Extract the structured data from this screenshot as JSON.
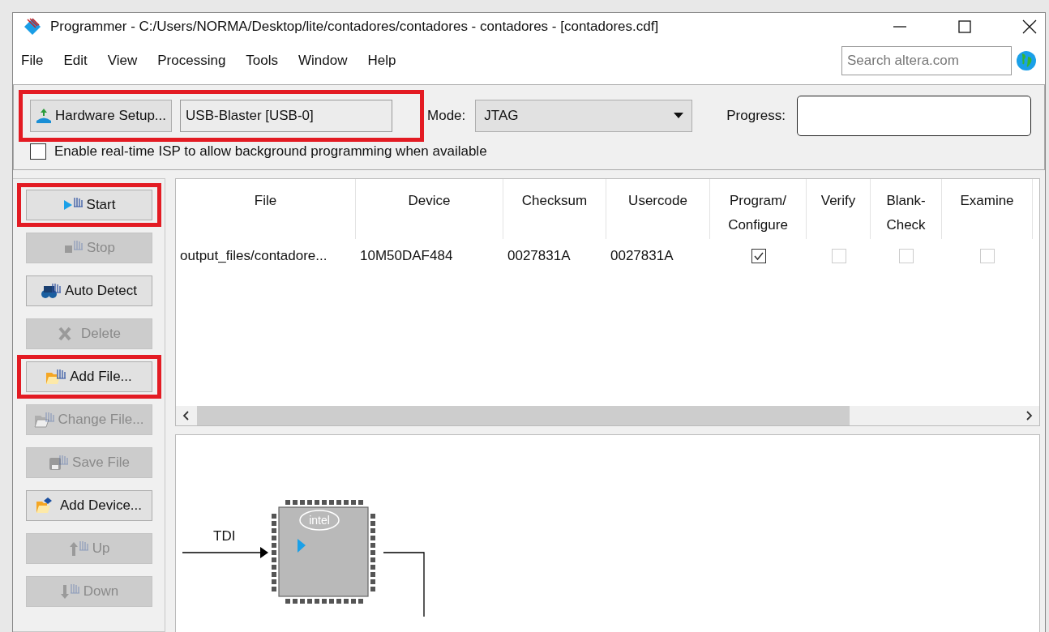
{
  "window": {
    "title": "Programmer - C:/Users/NORMA/Desktop/lite/contadores/contadores - contadores - [contadores.cdf]"
  },
  "menu": [
    "File",
    "Edit",
    "View",
    "Processing",
    "Tools",
    "Window",
    "Help"
  ],
  "search": {
    "placeholder": "Search altera.com"
  },
  "hardware": {
    "button": "Hardware Setup...",
    "device": "USB-Blaster [USB-0]",
    "highlighted": true
  },
  "mode": {
    "label": "Mode:",
    "value": "JTAG"
  },
  "progress": {
    "label": "Progress:"
  },
  "isp": {
    "label": "Enable real-time ISP to allow background programming when available",
    "checked": false
  },
  "buttons": [
    {
      "label": "Start",
      "kind": "start",
      "disabled": false,
      "highlighted": true
    },
    {
      "label": "Stop",
      "kind": "stop",
      "disabled": true,
      "highlighted": false
    },
    {
      "label": "Auto Detect",
      "kind": "detect",
      "disabled": false,
      "highlighted": false
    },
    {
      "label": "Delete",
      "kind": "delete",
      "disabled": true,
      "highlighted": false
    },
    {
      "label": "Add File...",
      "kind": "addfile",
      "disabled": false,
      "highlighted": true
    },
    {
      "label": "Change File...",
      "kind": "changefile",
      "disabled": true,
      "highlighted": false
    },
    {
      "label": "Save File",
      "kind": "save",
      "disabled": true,
      "highlighted": false
    },
    {
      "label": "Add Device...",
      "kind": "adddevice",
      "disabled": false,
      "highlighted": false
    },
    {
      "label": "Up",
      "kind": "up",
      "disabled": true,
      "highlighted": false
    },
    {
      "label": "Down",
      "kind": "down",
      "disabled": true,
      "highlighted": false
    }
  ],
  "table": {
    "columns": [
      {
        "lines": [
          "File"
        ]
      },
      {
        "lines": [
          "Device"
        ]
      },
      {
        "lines": [
          "Checksum"
        ]
      },
      {
        "lines": [
          "Usercode"
        ]
      },
      {
        "lines": [
          "Program/",
          "Configure"
        ]
      },
      {
        "lines": [
          "Verify"
        ]
      },
      {
        "lines": [
          "Blank-",
          "Check"
        ]
      },
      {
        "lines": [
          "Examine"
        ]
      }
    ],
    "rows": [
      {
        "cells": [
          {
            "kind": "text",
            "text": "output_files/contadore..."
          },
          {
            "kind": "text",
            "text": "10M50DAF484"
          },
          {
            "kind": "text",
            "text": "0027831A"
          },
          {
            "kind": "text",
            "text": "0027831A"
          },
          {
            "kind": "check",
            "checked": true,
            "disabled": false
          },
          {
            "kind": "check",
            "checked": false,
            "disabled": true
          },
          {
            "kind": "check",
            "checked": false,
            "disabled": true
          },
          {
            "kind": "check",
            "checked": false,
            "disabled": true
          }
        ]
      }
    ]
  },
  "diagram": {
    "input_label": "TDI",
    "chip_logo": "intel"
  }
}
